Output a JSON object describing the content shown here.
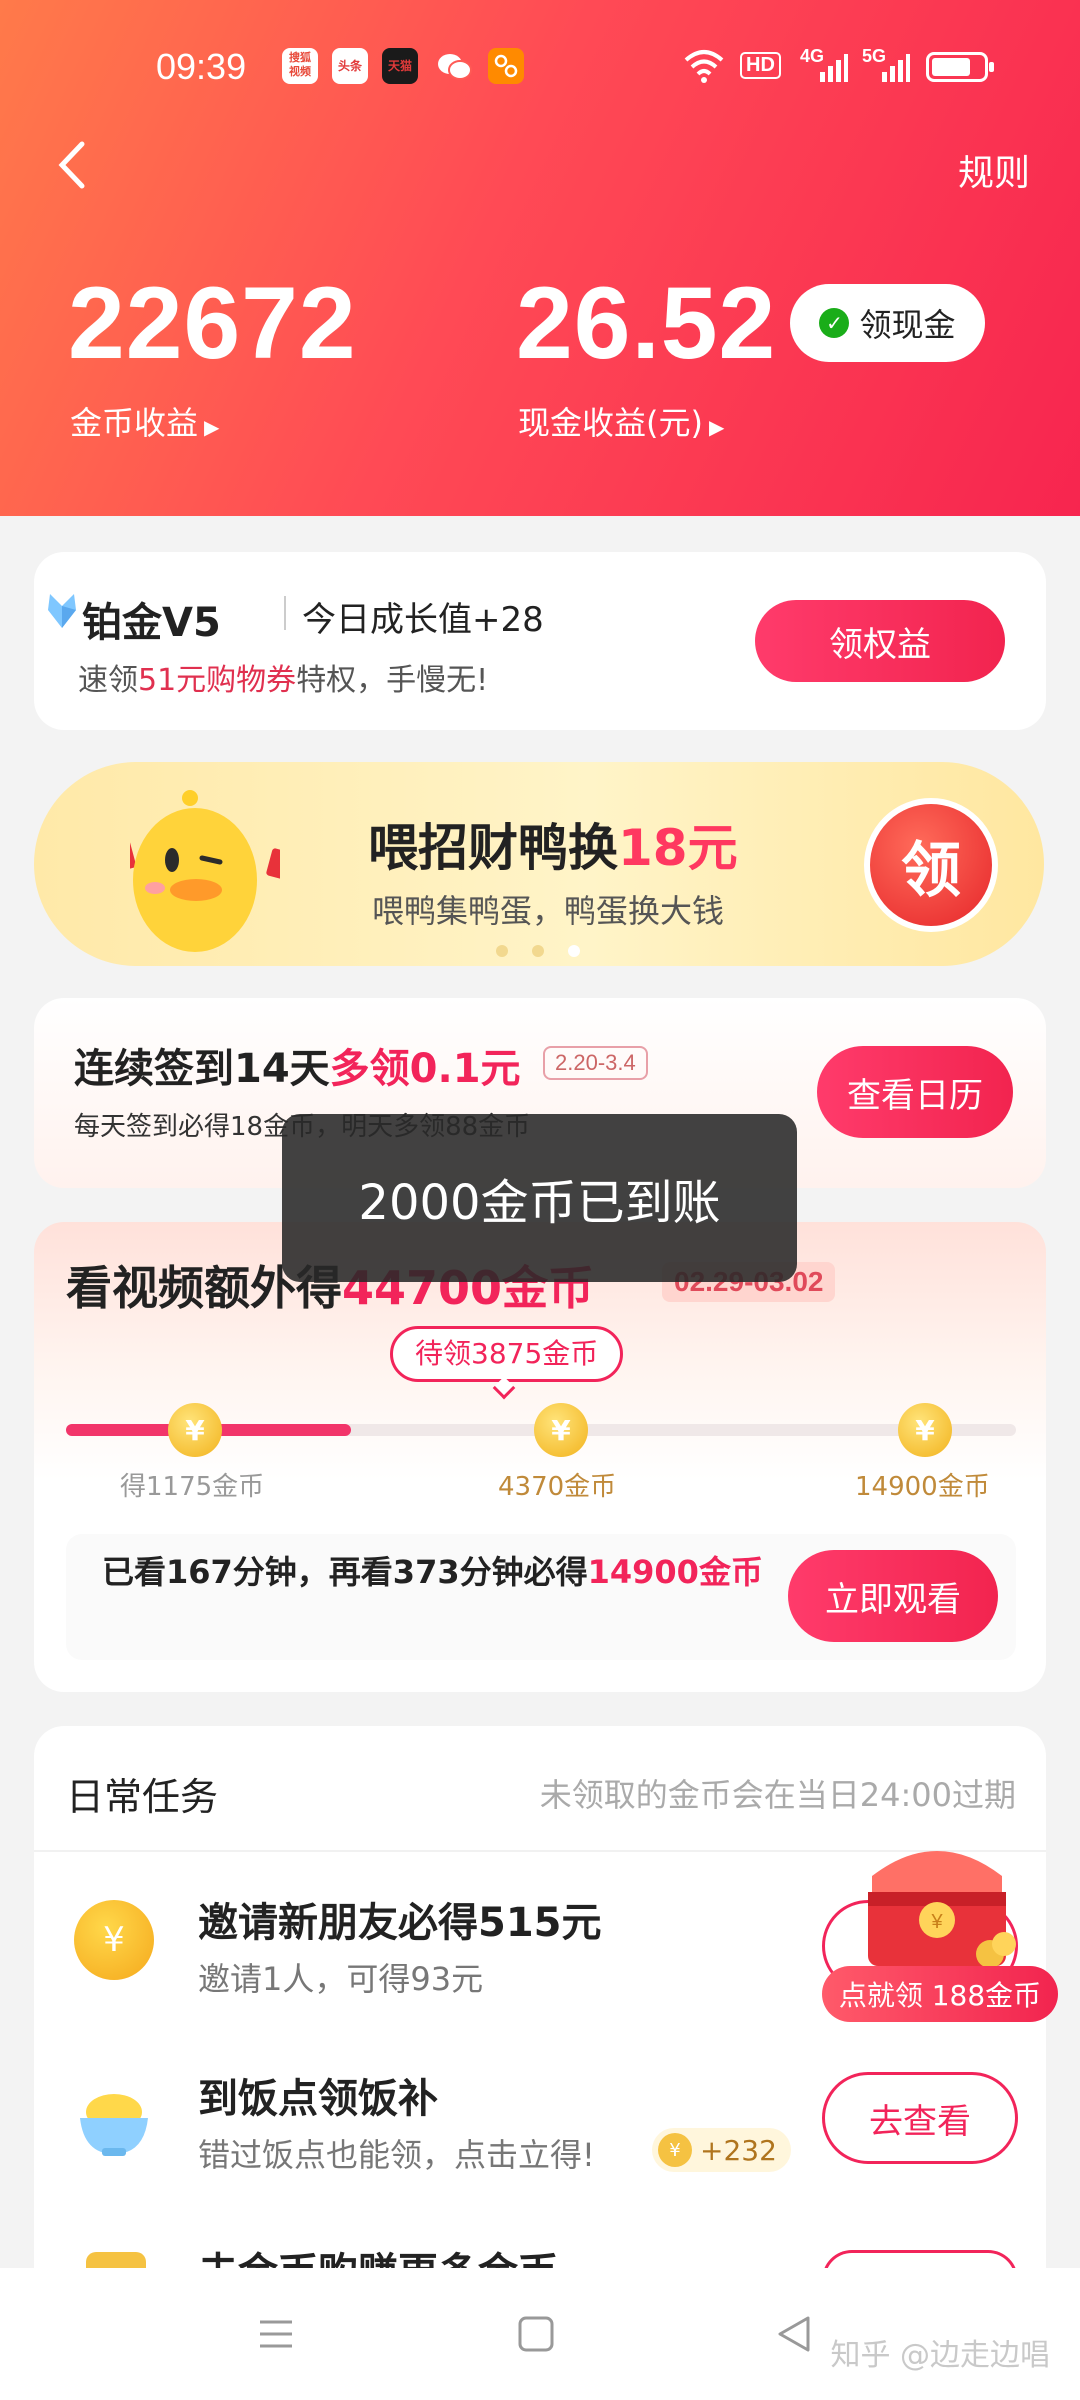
{
  "status_bar": {
    "time": "09:39",
    "apps": [
      {
        "name": "搜狐视频",
        "color": "#e84a3a",
        "icon": "app-icon-1"
      },
      {
        "name": "头条",
        "color": "#e23a3a",
        "icon": "app-icon-2"
      },
      {
        "name": "天猫",
        "color": "#1a1a1a",
        "icon": "app-icon-3"
      },
      {
        "name": "wechat",
        "color": "#ffffff",
        "icon": "wechat-icon"
      },
      {
        "name": "app",
        "color": "#ff8a00",
        "icon": "app-icon-5"
      }
    ],
    "network_1": "HD",
    "network_2": "4G",
    "network_3": "5G"
  },
  "header": {
    "rules_label": "规则",
    "coins_value": "22672",
    "coins_label": "金币收益",
    "cash_value": "26.52",
    "cash_label": "现金收益(元)",
    "cash_button_label": "领现金",
    "arrow": "▶"
  },
  "platinum": {
    "level": "铂金V5",
    "growth": "今日成长值+28",
    "desc_prefix": "速领",
    "desc_highlight": "51元购物券",
    "desc_suffix": "特权，手慢无!",
    "button_label": "领权益"
  },
  "duck_banner": {
    "title_prefix": "喂招财鸭换",
    "title_highlight": "18元",
    "subtitle": "喂鸭集鸭蛋，鸭蛋换大钱",
    "button_label": "领",
    "carousel_active": 2
  },
  "signin": {
    "title_prefix": "连续签到14天",
    "title_highlight": "多领0.1元",
    "date_range": "2.20-3.4",
    "desc": "每天签到必得18金币，明天多领88金币",
    "button_label": "查看日历"
  },
  "video": {
    "title_prefix": "看视频额外得",
    "title_highlight": "44700金币",
    "date_range": "02.29-03.02",
    "pending_label": "待领3875金币",
    "progress": 0.3,
    "milestones": [
      "得1175金币",
      "4370金币",
      "14900金币"
    ],
    "coin_symbol": "¥",
    "watch_text_prefix": "已看167分钟，再看373分钟必得",
    "watch_text_highlight": "14900金币",
    "button_label": "立即观看"
  },
  "daily": {
    "title": "日常任务",
    "note": "未领取的金币会在当日24:00过期",
    "tasks": [
      {
        "title": "邀请新朋友必得515元",
        "subtitle": "邀请1人，可得93元",
        "icon": "coin-icon"
      },
      {
        "title": "到饭点领饭补",
        "subtitle": "错过饭点也能领，点击立得!",
        "reward": "+232",
        "button_label": "去查看",
        "icon": "rice-bowl-icon"
      },
      {
        "title": "去金币购赚更多金币",
        "icon": "shopping-icon"
      }
    ],
    "chest_badge": "点就领 188金币"
  },
  "toast": {
    "message": "2000金币已到账"
  },
  "navbar": {
    "watermark": "知乎 @边走边唱"
  },
  "colors": {
    "accent": "#f2245a",
    "header_start": "#ff7a4a",
    "header_end": "#f7254f",
    "gold": "#f2b21c"
  }
}
